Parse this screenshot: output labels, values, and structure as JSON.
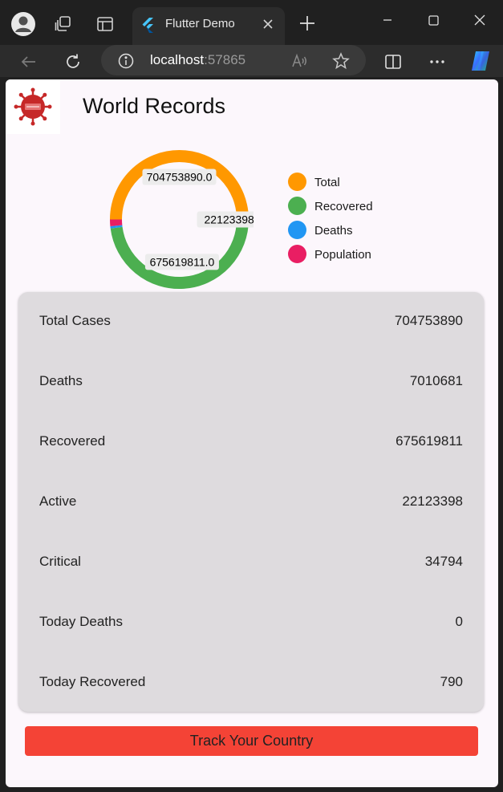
{
  "browser": {
    "tab_title": "Flutter Demo",
    "url_host": "localhost",
    "url_port": ":57865",
    "icons": {
      "profile": "profile-icon",
      "workspaces": "workspaces-icon",
      "tab_actions": "tab-actions-icon",
      "favicon": "flutter-icon",
      "close_tab": "close-icon",
      "new_tab": "plus-icon",
      "minimize": "minimize-icon",
      "maximize": "maximize-icon",
      "close_window": "close-icon",
      "back": "back-arrow-icon",
      "reload": "reload-icon",
      "site_info": "info-icon",
      "read_aloud": "read-aloud-icon",
      "favorite": "star-icon",
      "split_screen": "split-screen-icon",
      "more": "more-icon",
      "copilot": "copilot-icon"
    }
  },
  "page": {
    "title": "World Records",
    "logo_icon": "virus-icon"
  },
  "chart_data": {
    "type": "pie",
    "style": "donut",
    "slices": [
      {
        "name": "Total",
        "value": 704753890.0,
        "label": "704753890.0",
        "color": "#ff9800"
      },
      {
        "name": "Recovered",
        "value": 675619811.0,
        "label": "675619811.0",
        "color": "#4caf50"
      },
      {
        "name": "Deaths",
        "value": 7010681.0,
        "label": "",
        "color": "#2196f3"
      },
      {
        "name": "Population",
        "value": 22123398.0,
        "label": "22123398.0",
        "color": "#e91e63"
      }
    ],
    "legend_position": "right"
  },
  "legend": [
    {
      "label": "Total",
      "color": "#ff9800"
    },
    {
      "label": "Recovered",
      "color": "#4caf50"
    },
    {
      "label": "Deaths",
      "color": "#2196f3"
    },
    {
      "label": "Population",
      "color": "#e91e63"
    }
  ],
  "stats": [
    {
      "label": "Total Cases",
      "value": "704753890"
    },
    {
      "label": "Deaths",
      "value": "7010681"
    },
    {
      "label": "Recovered",
      "value": "675619811"
    },
    {
      "label": "Active",
      "value": "22123398"
    },
    {
      "label": "Critical",
      "value": "34794"
    },
    {
      "label": "Today Deaths",
      "value": "0"
    },
    {
      "label": "Today Recovered",
      "value": "790"
    }
  ],
  "track_button": {
    "label": "Track Your Country",
    "color": "#f44336"
  }
}
